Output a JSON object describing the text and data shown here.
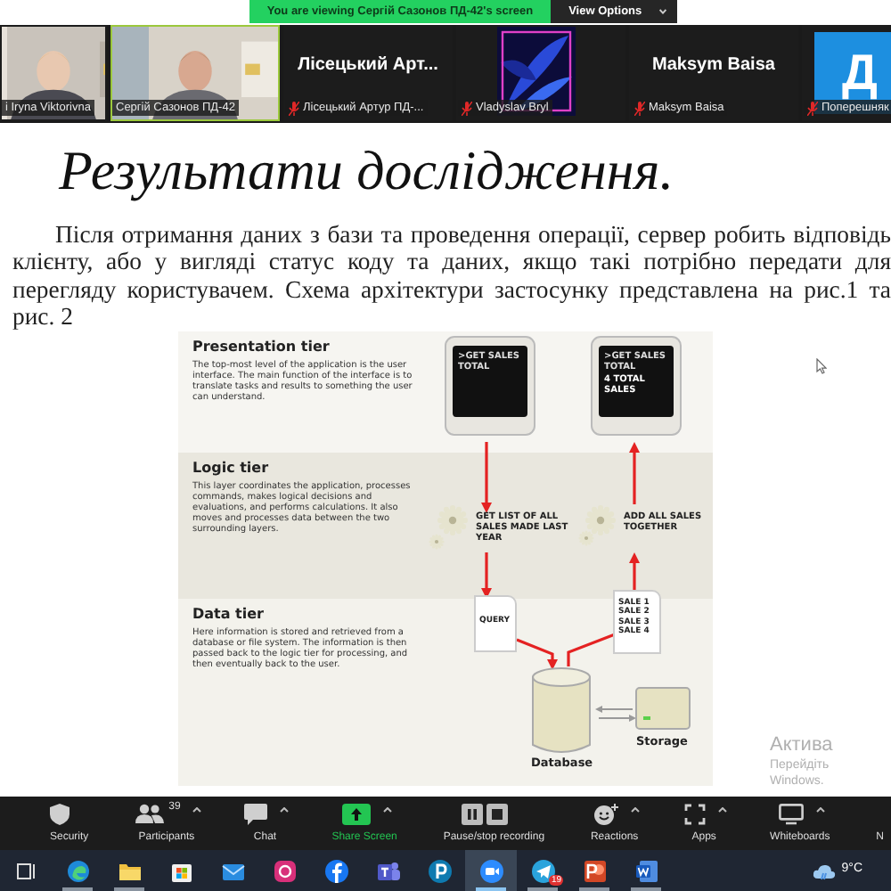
{
  "banner": {
    "text": "You are viewing Сергій Сазонов ПД-42's screen",
    "button": "View Options"
  },
  "participants": [
    {
      "kind": "video",
      "name": "i Iryna Viktorivna",
      "muted": false,
      "selected": false
    },
    {
      "kind": "video",
      "name": "Сергій Сазонов ПД-42",
      "muted": false,
      "selected": true
    },
    {
      "kind": "name",
      "display": "Лісецький  Арт...",
      "name": "Лісецький Артур  ПД-...",
      "muted": true,
      "selected": false
    },
    {
      "kind": "art",
      "name": "Vladyslav Bryl",
      "muted": true,
      "selected": false
    },
    {
      "kind": "name",
      "display": "Maksym Baisa",
      "name": "Maksym Baisa",
      "muted": true,
      "selected": false
    },
    {
      "kind": "avatar",
      "avatar": "Д",
      "name": "Поперешняк",
      "muted": true,
      "selected": false
    }
  ],
  "document": {
    "title": "Результати дослідження.",
    "paragraph": "Після отримання даних з бази та проведення операції, сервер робить відповідь клієнту, або у вигляді статус коду та даних, якщо такі потрібно передати для перегляду користувачем. Схема архітектури застосунку представлена на рис.1 та рис. 2",
    "diagram": {
      "tiers": [
        {
          "title": "Presentation tier",
          "text": "The top-most level of the application is the user interface. The main function of the interface is to translate tasks and results to something the user can understand."
        },
        {
          "title": "Logic tier",
          "text": "This layer coordinates the application, processes commands, makes logical decisions and evaluations, and performs calculations.  It also moves and processes data between the two surrounding layers."
        },
        {
          "title": "Data tier",
          "text": "Here information is stored and retrieved from a database or file system.  The information is then passed back to the logic tier for processing, and then eventually back to the user."
        }
      ],
      "screen_1": [
        ">GET SALES",
        "TOTAL"
      ],
      "screen_2": [
        ">GET SALES",
        "TOTAL",
        "4 TOTAL SALES"
      ],
      "step_1": "GET LIST OF ALL SALES MADE LAST YEAR",
      "step_2": "ADD ALL SALES TOGETHER",
      "query": "QUERY",
      "sales": [
        "SALE 1",
        "SALE 2",
        "SALE 3",
        "SALE 4"
      ],
      "database": "Database",
      "storage": "Storage"
    }
  },
  "watermark": [
    "Актива",
    "Перейдіть",
    "Windows."
  ],
  "toolbar": [
    {
      "kind": "security",
      "label": "Security",
      "caret": false
    },
    {
      "kind": "participants",
      "label": "Participants",
      "count": "39",
      "caret": true
    },
    {
      "kind": "chat",
      "label": "Chat",
      "caret": true
    },
    {
      "kind": "share",
      "label": "Share Screen",
      "caret": true
    },
    {
      "kind": "record",
      "label": "Pause/stop recording",
      "caret": false
    },
    {
      "kind": "reactions",
      "label": "Reactions",
      "caret": true
    },
    {
      "kind": "apps",
      "label": "Apps",
      "caret": true
    },
    {
      "kind": "whiteboards",
      "label": "Whiteboards",
      "caret": true
    },
    {
      "kind": "more",
      "label": "N",
      "caret": false
    }
  ],
  "taskbar": {
    "apps": [
      {
        "kind": "taskview",
        "open": false,
        "selected": false
      },
      {
        "kind": "edge",
        "open": true,
        "selected": false
      },
      {
        "kind": "folder",
        "open": true,
        "selected": false
      },
      {
        "kind": "store",
        "open": false,
        "selected": false
      },
      {
        "kind": "mail",
        "open": false,
        "selected": false
      },
      {
        "kind": "instagram",
        "open": false,
        "selected": false
      },
      {
        "kind": "facebook",
        "open": false,
        "selected": false
      },
      {
        "kind": "teams",
        "open": false,
        "selected": false
      },
      {
        "kind": "pearson",
        "open": false,
        "selected": false
      },
      {
        "kind": "zoom",
        "open": true,
        "selected": true
      },
      {
        "kind": "telegram",
        "open": true,
        "selected": false,
        "badge": "19"
      },
      {
        "kind": "powerpoint",
        "open": true,
        "selected": false
      },
      {
        "kind": "word",
        "open": true,
        "selected": false
      }
    ],
    "weather": "9°C"
  }
}
